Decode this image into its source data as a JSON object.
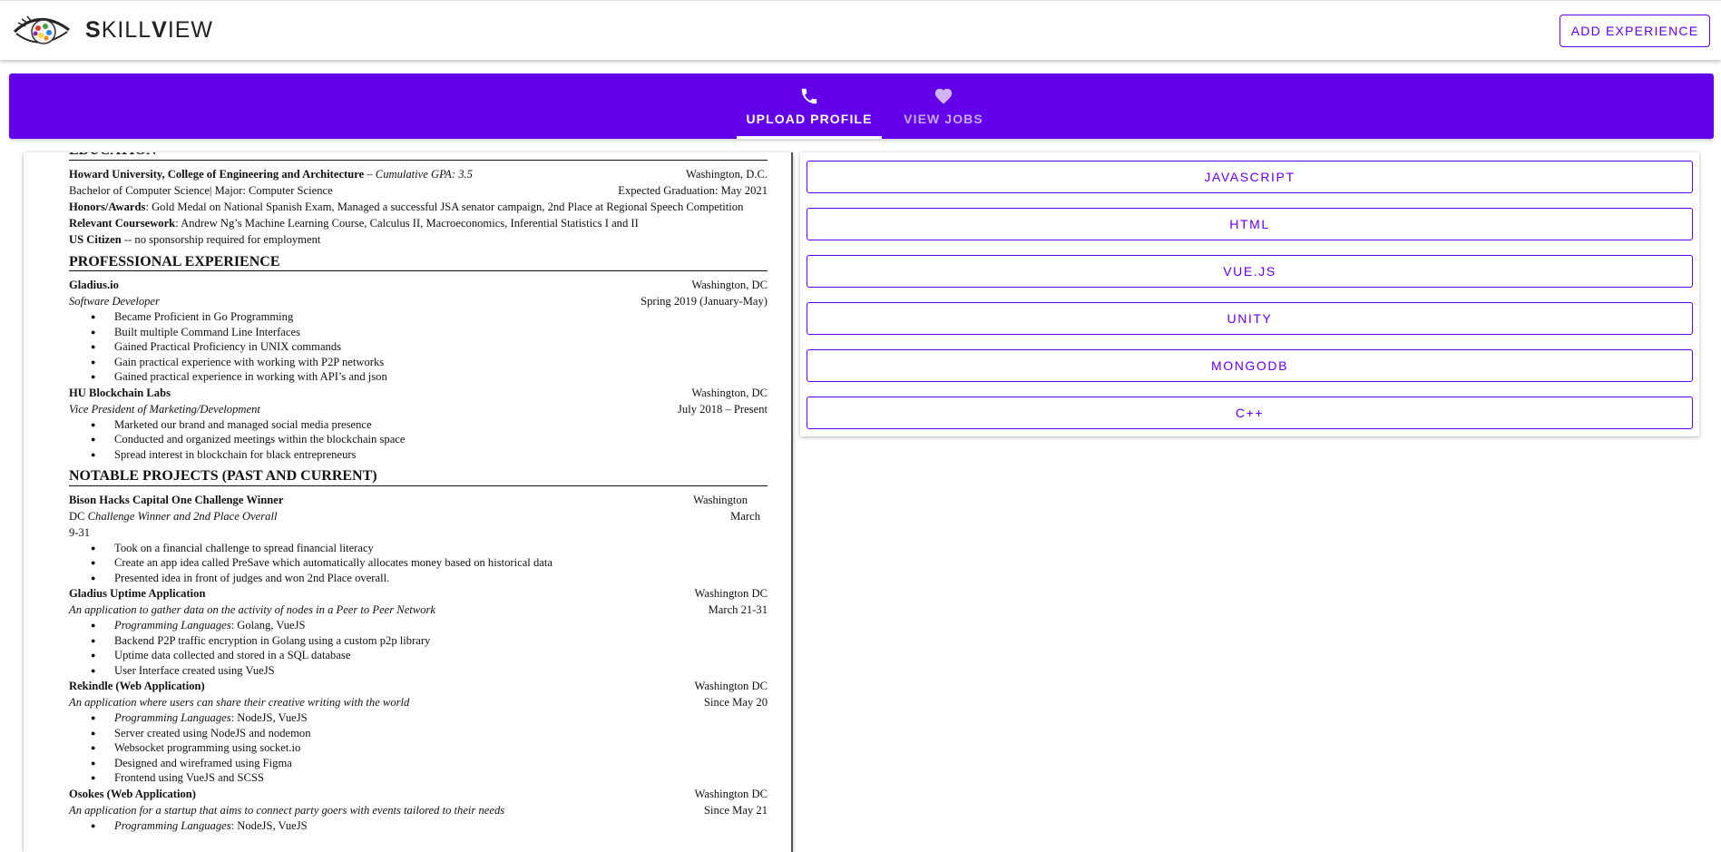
{
  "header": {
    "brand_prefix_bold": "S",
    "brand_mid": "KILL",
    "brand_bold2": "V",
    "brand_suffix": "IEW",
    "add_button": "ADD EXPERIENCE",
    "logo_icon": "eye-logo-icon"
  },
  "tabs": [
    {
      "label": "UPLOAD PROFILE",
      "icon": "phone-icon",
      "active": true
    },
    {
      "label": "VIEW JOBS",
      "icon": "heart-icon",
      "active": false
    }
  ],
  "colors": {
    "accent": "#6200ea"
  },
  "skills": [
    "JAVASCRIPT",
    "HTML",
    "VUE.JS",
    "UNITY",
    "MONGODB",
    "C++"
  ],
  "resume": {
    "edu_head": "EDUCATION",
    "edu_school": "Howard University, College of Engineering and Architecture",
    "edu_gpa": " – Cumulative GPA: 3.5",
    "edu_loc": "Washington, D.C.",
    "edu_degree": "Bachelor of Computer Science| Major: Computer Science",
    "edu_grad": "Expected Graduation: May 2021",
    "honors_label": "Honors/Awards",
    "honors_text": ": Gold Medal on National Spanish Exam, Managed a successful JSA senator campaign, 2nd Place at Regional Speech Competition",
    "course_label": "Relevant Coursework",
    "course_text": ": Andrew Ng’s Machine Learning Course, Calculus II, Macroeconomics,  Inferential Statistics I and II",
    "citizen_label": "US Citizen",
    "citizen_text": " -- no sponsorship required for employment",
    "exp_head": "PROFESSIONAL EXPERIENCE",
    "job1_company": "Gladius.io",
    "job1_loc": "Washington, DC",
    "job1_title": "Software Developer",
    "job1_date": "Spring 2019 (January-May)",
    "job1_b": [
      "Became Proficient in Go Programming",
      "Built multiple Command Line Interfaces",
      "Gained Practical Proficiency in UNIX commands",
      "Gain practical experience with working with P2P networks",
      "Gained practical experience in working with API’s and json"
    ],
    "job2_company": "HU Blockchain Labs",
    "job2_loc": "Washington, DC",
    "job2_title": "Vice President of Marketing/Development",
    "job2_date": "July 2018 – Present",
    "job2_b": [
      "Marketed our brand and managed social media presence",
      "Conducted and organized meetings within the blockchain space",
      "Spread interest in blockchain for black entrepreneurs"
    ],
    "proj_head": "NOTABLE PROJECTS (PAST AND CURRENT)",
    "p1_name": "Bison Hacks Capital One Challenge Winner",
    "p1_loc": "Washington",
    "p1_l2a": "DC ",
    "p1_l2b": "Challenge Winner and 2nd Place Overall",
    "p1_l2c": "March",
    "p1_l3": "9-31",
    "p1_b": [
      "Took on a financial challenge to spread financial literacy",
      "Create an app idea called PreSave which automatically allocates money based on historical data",
      "Presented idea in front of judges and won 2nd Place overall."
    ],
    "p2_name": "Gladius Uptime Application",
    "p2_loc": "Washington DC",
    "p2_desc": "An application to gather data on the activity of nodes in a Peer to Peer Network",
    "p2_date": "March  21-31",
    "p2_lang_label": "Programming Languages",
    "p2_lang": ": Golang, VueJS",
    "p2_b": [
      "Backend P2P traffic encryption in Golang using a custom p2p library",
      "Uptime data collected and stored in a SQL database",
      "User Interface created using VueJS"
    ],
    "p3_name": "Rekindle (Web Application)",
    "p3_loc": "Washington DC",
    "p3_desc": "An application where users can share their creative writing with the world",
    "p3_date": "Since May 20",
    "p3_lang_label": "Programming Languages",
    "p3_lang": ": NodeJS, VueJS",
    "p3_b": [
      "Server created using NodeJS and nodemon",
      "Websocket programming using socket.io",
      "Designed and wireframed using Figma",
      "Frontend using VueJS and SCSS"
    ],
    "p4_name": "Osokes (Web Application)",
    "p4_loc": "Washington DC",
    "p4_desc": "An application for a startup that aims to connect party goers with events tailored to their needs",
    "p4_date": "Since May 21",
    "p4_lang_label": "Programming Languages",
    "p4_lang": ": NodeJS, VueJS"
  }
}
